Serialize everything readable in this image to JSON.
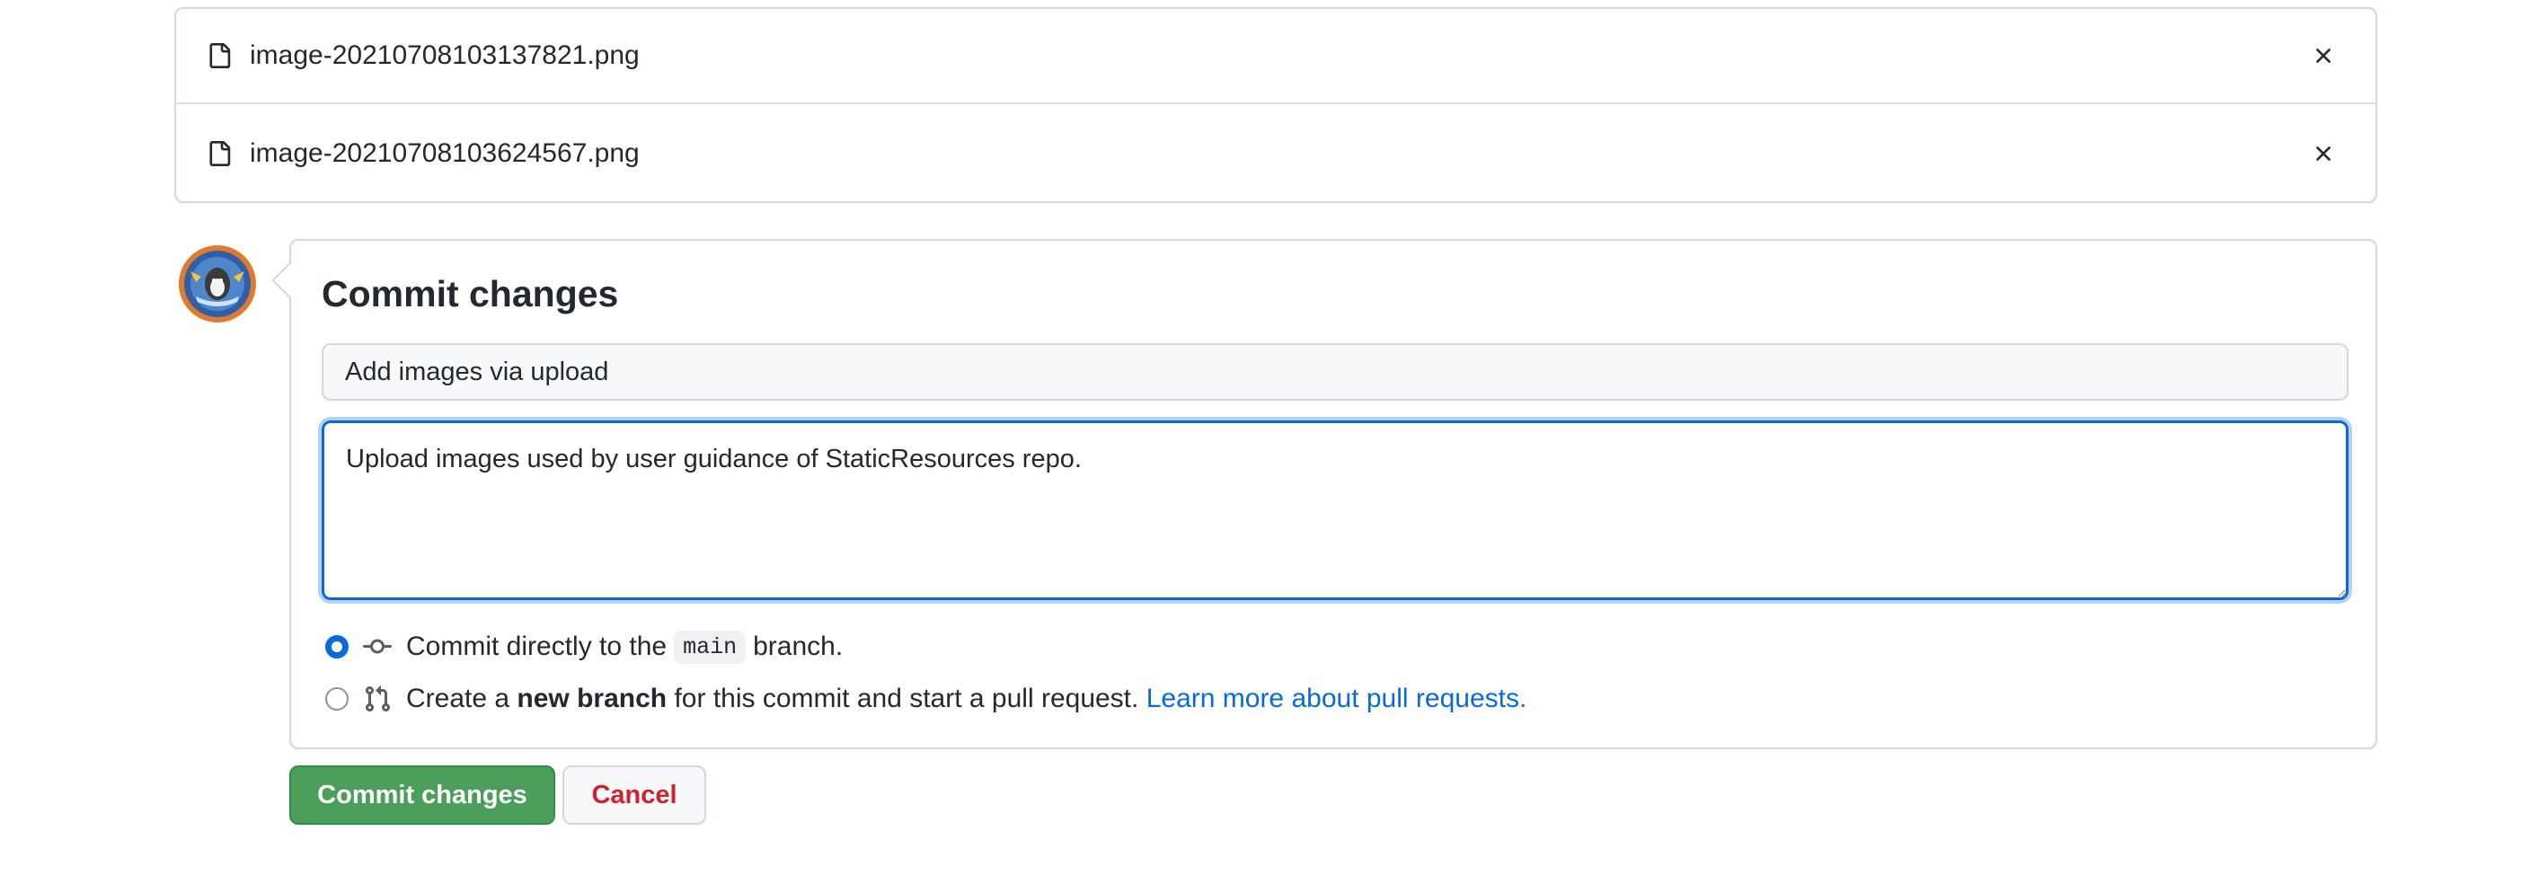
{
  "files": [
    {
      "name": "image-20210708103137821.png",
      "icon": "file-icon",
      "remove_icon": "close-icon"
    },
    {
      "name": "image-20210708103624567.png",
      "icon": "file-icon",
      "remove_icon": "close-icon"
    }
  ],
  "commit": {
    "title": "Commit changes",
    "summary_value": "Add images via upload",
    "description_value": "Upload images used by user guidance of StaticResources repo.",
    "options": {
      "direct": {
        "selected": true,
        "icon": "git-commit-icon",
        "text_before": "Commit directly to the",
        "branch": "main",
        "text_after": "branch."
      },
      "new_branch": {
        "selected": false,
        "icon": "git-pull-request-icon",
        "text_before": "Create a",
        "bold": "new branch",
        "text_after": "for this commit and start a pull request.",
        "link": "Learn more about pull requests."
      }
    }
  },
  "buttons": {
    "commit_label": "Commit changes",
    "cancel_label": "Cancel"
  },
  "colors": {
    "accent": "#0969da",
    "commit_button": "#4c9f5a",
    "cancel_text": "#cf222e"
  }
}
